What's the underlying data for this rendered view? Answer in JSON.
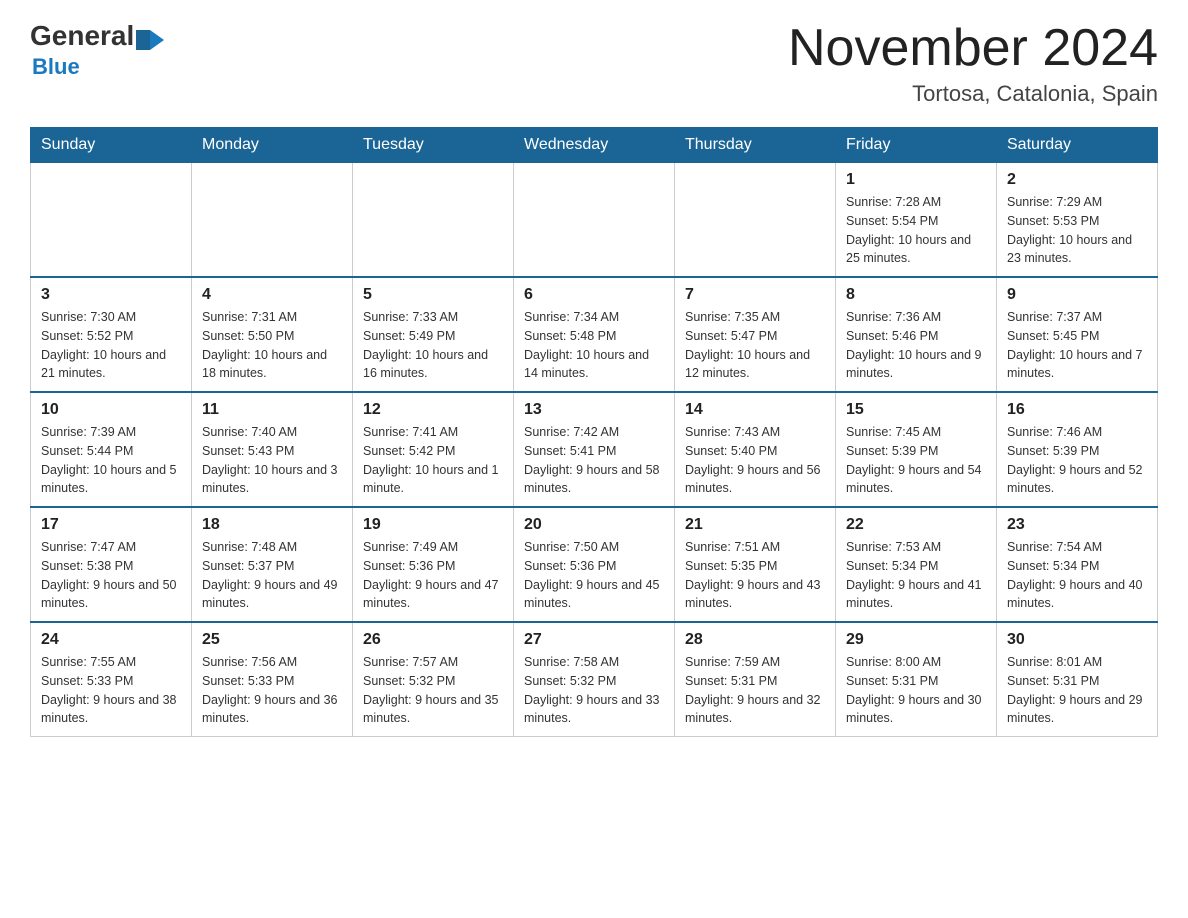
{
  "header": {
    "logo_general": "General",
    "logo_blue": "Blue",
    "month_title": "November 2024",
    "location": "Tortosa, Catalonia, Spain"
  },
  "days_of_week": [
    "Sunday",
    "Monday",
    "Tuesday",
    "Wednesday",
    "Thursday",
    "Friday",
    "Saturday"
  ],
  "weeks": [
    [
      {
        "day": "",
        "info": ""
      },
      {
        "day": "",
        "info": ""
      },
      {
        "day": "",
        "info": ""
      },
      {
        "day": "",
        "info": ""
      },
      {
        "day": "",
        "info": ""
      },
      {
        "day": "1",
        "info": "Sunrise: 7:28 AM\nSunset: 5:54 PM\nDaylight: 10 hours and 25 minutes."
      },
      {
        "day": "2",
        "info": "Sunrise: 7:29 AM\nSunset: 5:53 PM\nDaylight: 10 hours and 23 minutes."
      }
    ],
    [
      {
        "day": "3",
        "info": "Sunrise: 7:30 AM\nSunset: 5:52 PM\nDaylight: 10 hours and 21 minutes."
      },
      {
        "day": "4",
        "info": "Sunrise: 7:31 AM\nSunset: 5:50 PM\nDaylight: 10 hours and 18 minutes."
      },
      {
        "day": "5",
        "info": "Sunrise: 7:33 AM\nSunset: 5:49 PM\nDaylight: 10 hours and 16 minutes."
      },
      {
        "day": "6",
        "info": "Sunrise: 7:34 AM\nSunset: 5:48 PM\nDaylight: 10 hours and 14 minutes."
      },
      {
        "day": "7",
        "info": "Sunrise: 7:35 AM\nSunset: 5:47 PM\nDaylight: 10 hours and 12 minutes."
      },
      {
        "day": "8",
        "info": "Sunrise: 7:36 AM\nSunset: 5:46 PM\nDaylight: 10 hours and 9 minutes."
      },
      {
        "day": "9",
        "info": "Sunrise: 7:37 AM\nSunset: 5:45 PM\nDaylight: 10 hours and 7 minutes."
      }
    ],
    [
      {
        "day": "10",
        "info": "Sunrise: 7:39 AM\nSunset: 5:44 PM\nDaylight: 10 hours and 5 minutes."
      },
      {
        "day": "11",
        "info": "Sunrise: 7:40 AM\nSunset: 5:43 PM\nDaylight: 10 hours and 3 minutes."
      },
      {
        "day": "12",
        "info": "Sunrise: 7:41 AM\nSunset: 5:42 PM\nDaylight: 10 hours and 1 minute."
      },
      {
        "day": "13",
        "info": "Sunrise: 7:42 AM\nSunset: 5:41 PM\nDaylight: 9 hours and 58 minutes."
      },
      {
        "day": "14",
        "info": "Sunrise: 7:43 AM\nSunset: 5:40 PM\nDaylight: 9 hours and 56 minutes."
      },
      {
        "day": "15",
        "info": "Sunrise: 7:45 AM\nSunset: 5:39 PM\nDaylight: 9 hours and 54 minutes."
      },
      {
        "day": "16",
        "info": "Sunrise: 7:46 AM\nSunset: 5:39 PM\nDaylight: 9 hours and 52 minutes."
      }
    ],
    [
      {
        "day": "17",
        "info": "Sunrise: 7:47 AM\nSunset: 5:38 PM\nDaylight: 9 hours and 50 minutes."
      },
      {
        "day": "18",
        "info": "Sunrise: 7:48 AM\nSunset: 5:37 PM\nDaylight: 9 hours and 49 minutes."
      },
      {
        "day": "19",
        "info": "Sunrise: 7:49 AM\nSunset: 5:36 PM\nDaylight: 9 hours and 47 minutes."
      },
      {
        "day": "20",
        "info": "Sunrise: 7:50 AM\nSunset: 5:36 PM\nDaylight: 9 hours and 45 minutes."
      },
      {
        "day": "21",
        "info": "Sunrise: 7:51 AM\nSunset: 5:35 PM\nDaylight: 9 hours and 43 minutes."
      },
      {
        "day": "22",
        "info": "Sunrise: 7:53 AM\nSunset: 5:34 PM\nDaylight: 9 hours and 41 minutes."
      },
      {
        "day": "23",
        "info": "Sunrise: 7:54 AM\nSunset: 5:34 PM\nDaylight: 9 hours and 40 minutes."
      }
    ],
    [
      {
        "day": "24",
        "info": "Sunrise: 7:55 AM\nSunset: 5:33 PM\nDaylight: 9 hours and 38 minutes."
      },
      {
        "day": "25",
        "info": "Sunrise: 7:56 AM\nSunset: 5:33 PM\nDaylight: 9 hours and 36 minutes."
      },
      {
        "day": "26",
        "info": "Sunrise: 7:57 AM\nSunset: 5:32 PM\nDaylight: 9 hours and 35 minutes."
      },
      {
        "day": "27",
        "info": "Sunrise: 7:58 AM\nSunset: 5:32 PM\nDaylight: 9 hours and 33 minutes."
      },
      {
        "day": "28",
        "info": "Sunrise: 7:59 AM\nSunset: 5:31 PM\nDaylight: 9 hours and 32 minutes."
      },
      {
        "day": "29",
        "info": "Sunrise: 8:00 AM\nSunset: 5:31 PM\nDaylight: 9 hours and 30 minutes."
      },
      {
        "day": "30",
        "info": "Sunrise: 8:01 AM\nSunset: 5:31 PM\nDaylight: 9 hours and 29 minutes."
      }
    ]
  ]
}
